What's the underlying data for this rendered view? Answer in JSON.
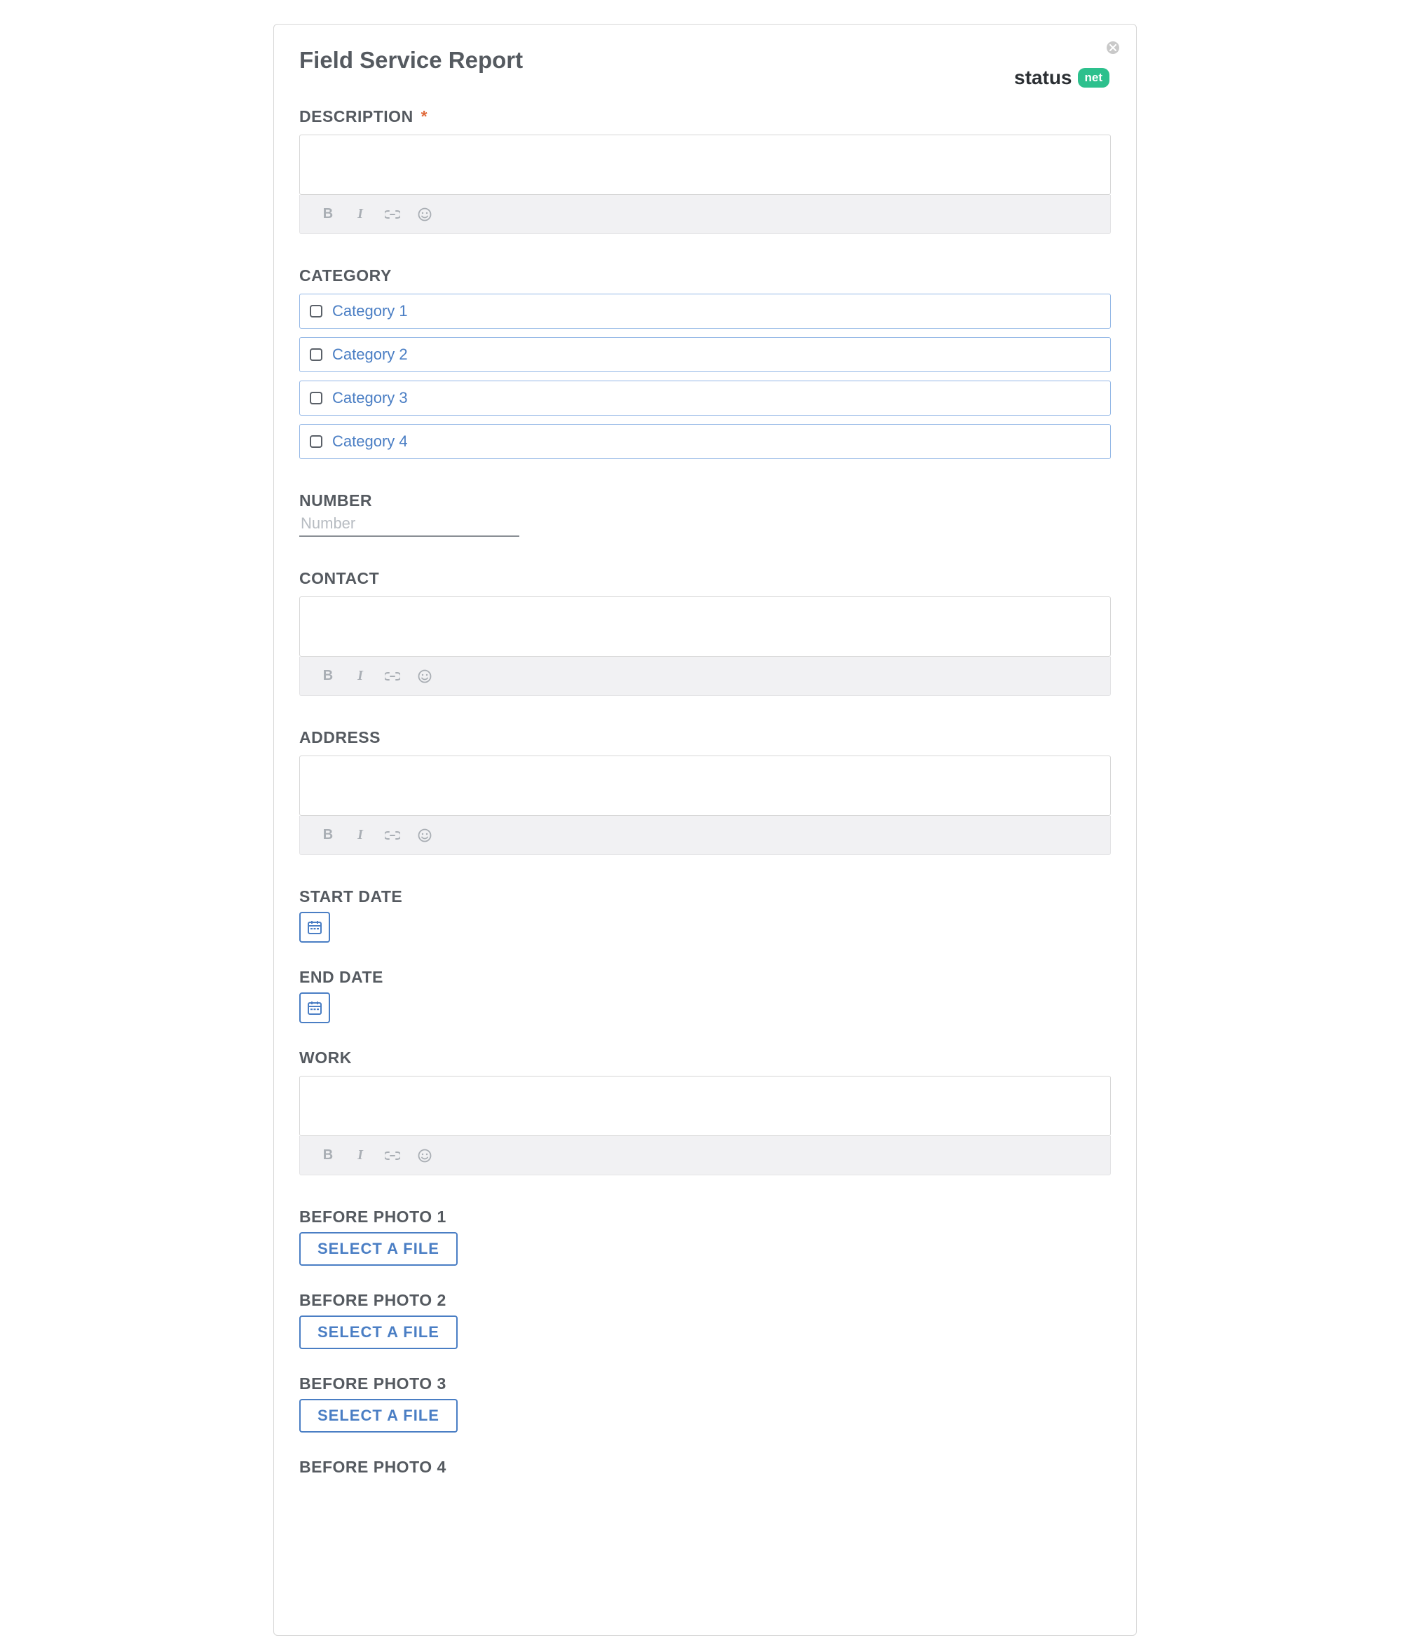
{
  "title": "Field Service Report",
  "brand": {
    "word": "status",
    "badge": "net"
  },
  "labels": {
    "description": "DESCRIPTION",
    "category": "CATEGORY",
    "number": "NUMBER",
    "contact": "CONTACT",
    "address": "ADDRESS",
    "start_date": "START DATE",
    "end_date": "END DATE",
    "work": "WORK"
  },
  "required_mark": "*",
  "categories": [
    {
      "label": "Category 1"
    },
    {
      "label": "Category 2"
    },
    {
      "label": "Category 3"
    },
    {
      "label": "Category 4"
    }
  ],
  "number_placeholder": "Number",
  "file_button_label": "SELECT A FILE",
  "photo_blocks": [
    {
      "label": "BEFORE PHOTO 1"
    },
    {
      "label": "BEFORE PHOTO 2"
    },
    {
      "label": "BEFORE PHOTO 3"
    },
    {
      "label": "BEFORE PHOTO 4"
    }
  ],
  "toolbar": {
    "bold": "B",
    "italic": "I"
  }
}
